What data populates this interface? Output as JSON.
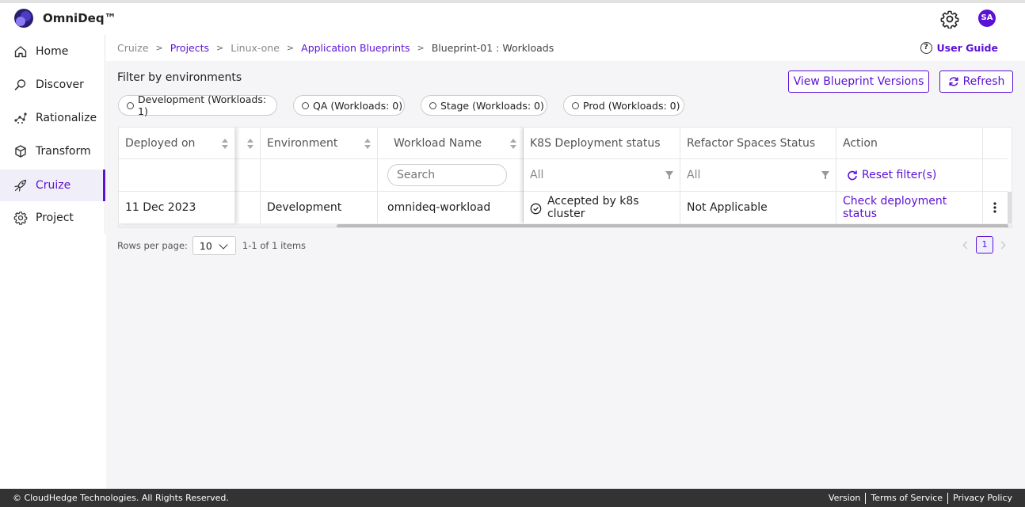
{
  "app": {
    "brand": "OmniDeq™",
    "avatar_initials": "SA",
    "accent": "#5b10d6"
  },
  "sidebar": {
    "items": [
      {
        "label": "Home",
        "icon": "home-icon"
      },
      {
        "label": "Discover",
        "icon": "discover-icon"
      },
      {
        "label": "Rationalize",
        "icon": "rationalize-icon"
      },
      {
        "label": "Transform",
        "icon": "cube-icon"
      },
      {
        "label": "Cruize",
        "icon": "rocket-icon",
        "active": true
      },
      {
        "label": "Project",
        "icon": "gear-icon"
      }
    ]
  },
  "breadcrumb": [
    "Cruize",
    "Projects",
    "Linux-one",
    "Application Blueprints",
    "Blueprint-01 : Workloads"
  ],
  "user_guide": "User Guide",
  "filter": {
    "title": "Filter by environments",
    "chips": [
      "Development (Workloads: 1)",
      "QA (Workloads: 0)",
      "Stage (Workloads: 0)",
      "Prod (Workloads: 0)"
    ]
  },
  "buttons": {
    "versions": "View Blueprint Versions",
    "refresh": "Refresh"
  },
  "table": {
    "columns": [
      "Deployed on",
      "",
      "Environment",
      "Workload Name",
      "K8S Deployment status",
      "Refactor Spaces Status",
      "Action"
    ],
    "filters": {
      "search_placeholder": "Search",
      "k8s": "All",
      "refactor": "All",
      "reset": "Reset filter(s)"
    },
    "rows": [
      {
        "deployed_on": "11 Dec 2023",
        "environment": "Development",
        "workload": "omnideq-workload",
        "k8s": "Accepted by k8s cluster",
        "refactor": "Not Applicable",
        "action": "Check deployment status"
      }
    ]
  },
  "pagination": {
    "rows_label": "Rows per page:",
    "rows_value": "10",
    "range": "1-1 of 1 items",
    "page": "1"
  },
  "footer": {
    "copyright": "© CloudHedge Technologies. All Rights Reserved.",
    "links": [
      "Version",
      "Terms of Service",
      "Privacy Policy"
    ]
  }
}
